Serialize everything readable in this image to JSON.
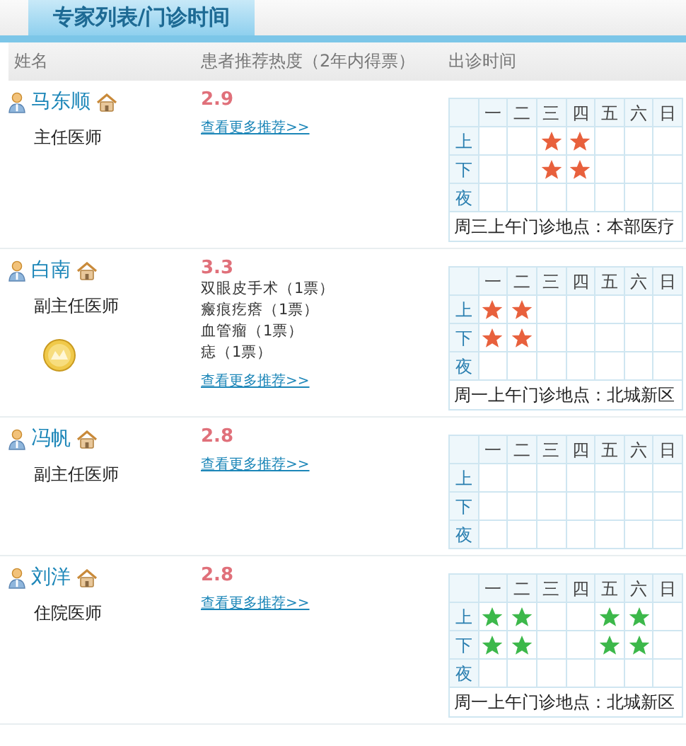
{
  "tab": {
    "label": "专家列表/门诊时间",
    "selected": true
  },
  "columns": [
    "姓名",
    "患者推荐热度（2年内得票）",
    "出诊时间"
  ],
  "doctors": [
    {
      "name": "马东顺",
      "title": "主任医师",
      "score": "2.9",
      "more_link": "查看更多推荐>>",
      "schedule": {
        "days": [
          "一",
          "二",
          "三",
          "四",
          "五",
          "六",
          "日"
        ],
        "color": "#e8603c",
        "rows": [
          {
            "label": "上",
            "slots": [
              false,
              false,
              true,
              true,
              false,
              false,
              false
            ]
          },
          {
            "label": "下",
            "slots": [
              false,
              false,
              true,
              true,
              false,
              false,
              false
            ]
          },
          {
            "label": "夜",
            "slots": [
              false,
              false,
              false,
              false,
              false,
              false,
              false
            ]
          }
        ],
        "note": "周三上午门诊地点：本部医疗"
      }
    },
    {
      "name": "白南",
      "title": "副主任医师",
      "medal": true,
      "score": "3.3",
      "recommendations": [
        "双眼皮手术（1票）",
        "瘢痕疙瘩（1票）",
        "血管瘤（1票）",
        "痣（1票）"
      ],
      "more_link": "查看更多推荐>>",
      "schedule": {
        "days": [
          "一",
          "二",
          "三",
          "四",
          "五",
          "六",
          "日"
        ],
        "color": "#e8603c",
        "rows": [
          {
            "label": "上",
            "slots": [
              true,
              true,
              false,
              false,
              false,
              false,
              false
            ]
          },
          {
            "label": "下",
            "slots": [
              true,
              true,
              false,
              false,
              false,
              false,
              false
            ]
          },
          {
            "label": "夜",
            "slots": [
              false,
              false,
              false,
              false,
              false,
              false,
              false
            ]
          }
        ],
        "note": "周一上午门诊地点：北城新区"
      }
    },
    {
      "name": "冯帆",
      "title": "副主任医师",
      "score": "2.8",
      "more_link": "查看更多推荐>>",
      "schedule": {
        "days": [
          "一",
          "二",
          "三",
          "四",
          "五",
          "六",
          "日"
        ],
        "rows": [
          {
            "label": "上",
            "slots": [
              false,
              false,
              false,
              false,
              false,
              false,
              false
            ]
          },
          {
            "label": "下",
            "slots": [
              false,
              false,
              false,
              false,
              false,
              false,
              false
            ]
          },
          {
            "label": "夜",
            "slots": [
              false,
              false,
              false,
              false,
              false,
              false,
              false
            ]
          }
        ]
      }
    },
    {
      "name": "刘洋",
      "title": "住院医师",
      "score": "2.8",
      "more_link": "查看更多推荐>>",
      "schedule": {
        "days": [
          "一",
          "二",
          "三",
          "四",
          "五",
          "六",
          "日"
        ],
        "color": "#3cb84a",
        "rows": [
          {
            "label": "上",
            "slots": [
              true,
              true,
              false,
              false,
              true,
              true,
              false
            ]
          },
          {
            "label": "下",
            "slots": [
              true,
              true,
              false,
              false,
              true,
              true,
              false
            ]
          },
          {
            "label": "夜",
            "slots": [
              false,
              false,
              false,
              false,
              false,
              false,
              false
            ]
          }
        ],
        "note": "周一上午门诊地点：北城新区"
      }
    }
  ]
}
